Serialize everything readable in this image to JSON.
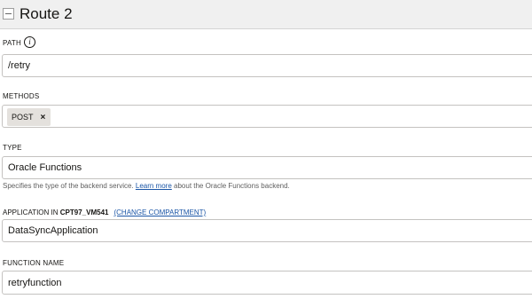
{
  "route": {
    "title": "Route 2"
  },
  "path": {
    "label": "PATH",
    "info_icon_glyph": "i",
    "value": "/retry"
  },
  "methods": {
    "label": "METHODS",
    "selected": [
      "POST"
    ],
    "remove_glyph": "×"
  },
  "type": {
    "label": "TYPE",
    "value": "Oracle Functions",
    "help_prefix": "Specifies the type of the backend service. ",
    "help_link": "Learn more",
    "help_suffix": " about the Oracle Functions backend."
  },
  "application": {
    "label_prefix": "APPLICATION IN ",
    "compartment": "CPT97_VM541",
    "change_link": "(CHANGE COMPARTMENT)",
    "value": "DataSyncApplication"
  },
  "function": {
    "label": "FUNCTION NAME",
    "value": "retryfunction"
  },
  "icons": {
    "collapse": "minus-icon",
    "info": "info-icon",
    "remove": "close-icon"
  },
  "colors": {
    "header_bg": "#f0f0f0",
    "link": "#1a55a6",
    "tag_bg": "#e4e1dd",
    "border": "#c4c2c0"
  }
}
